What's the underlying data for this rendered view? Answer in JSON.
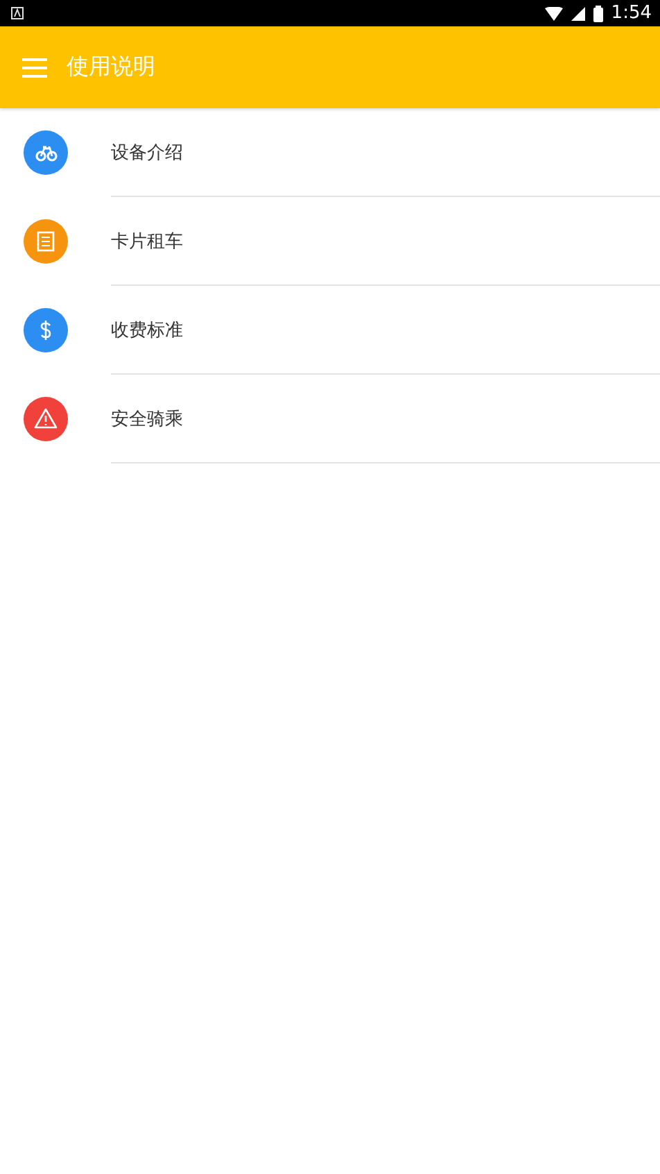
{
  "status_bar": {
    "time": "1:54"
  },
  "app_bar": {
    "title": "使用说明"
  },
  "items": [
    {
      "label": "设备介绍",
      "kind": "bike",
      "color": "#2b8ef0"
    },
    {
      "label": "卡片租车",
      "kind": "card",
      "color": "#f7940f"
    },
    {
      "label": "收费标准",
      "kind": "dollar",
      "color": "#2b8ef0"
    },
    {
      "label": "安全骑乘",
      "kind": "warning",
      "color": "#f0413a"
    }
  ]
}
